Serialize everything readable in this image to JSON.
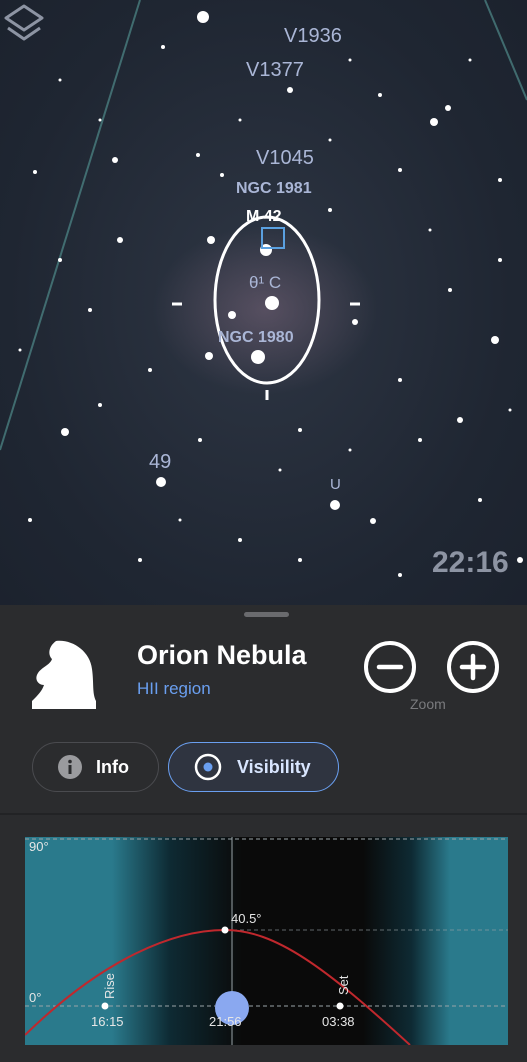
{
  "sky": {
    "labels": [
      {
        "id": "v1936",
        "text": "V1936"
      },
      {
        "id": "v1377",
        "text": "V1377"
      },
      {
        "id": "v1045",
        "text": "V1045"
      },
      {
        "id": "ngc1981",
        "text": "NGC 1981"
      },
      {
        "id": "m42",
        "text": "M 42"
      },
      {
        "id": "theta1c",
        "text": "θ¹ C"
      },
      {
        "id": "ngc1980",
        "text": "NGC 1980"
      },
      {
        "id": "star49",
        "text": "49"
      },
      {
        "id": "staru",
        "text": "U"
      }
    ],
    "time": "22:16",
    "layers_icon": "layers-icon"
  },
  "object": {
    "name": "Orion Nebula",
    "type": "HII region",
    "icon": "nebula-chess-knight-icon",
    "type_color": "#6a9ff0"
  },
  "zoom": {
    "label": "Zoom",
    "out_icon": "zoom-out-icon",
    "in_icon": "zoom-in-icon"
  },
  "tabs": [
    {
      "label": "Info",
      "icon": "info-icon",
      "selected": false
    },
    {
      "label": "Visibility",
      "icon": "target-icon",
      "selected": true
    }
  ],
  "visibility_chart": {
    "y_top_label": "90°",
    "y_zero_label": "0°",
    "rise_label": "Rise",
    "set_label": "Set",
    "rise_time": "16:15",
    "now_time": "21:56",
    "set_time": "03:38",
    "max_alt_label": "40.5°",
    "curve_color": "#c0282d",
    "twilight_color": "#2a7a8c"
  }
}
